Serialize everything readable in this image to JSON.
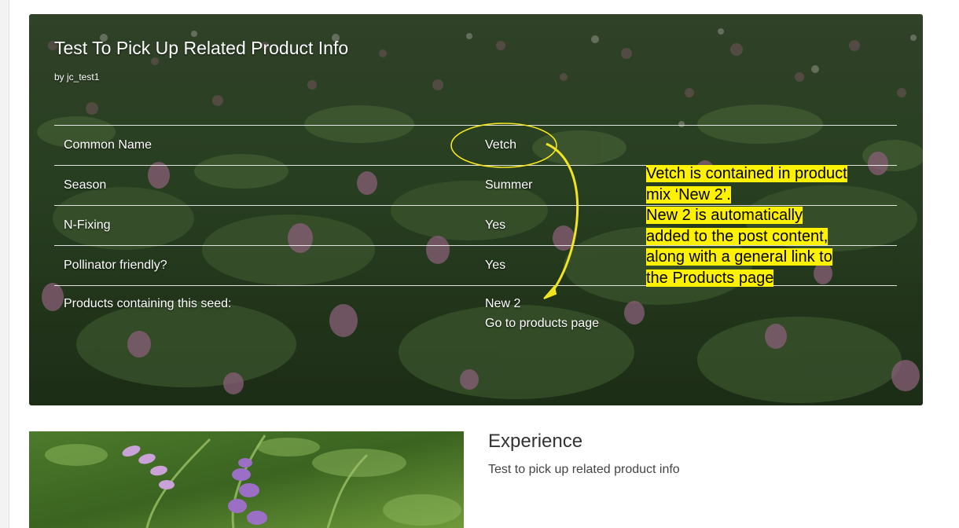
{
  "post": {
    "title": "Test To Pick Up Related Product Info",
    "author": "by jc_test1"
  },
  "table": {
    "rows": [
      {
        "label": "Common Name",
        "value": "Vetch"
      },
      {
        "label": "Season",
        "value": "Summer"
      },
      {
        "label": "N-Fixing",
        "value": "Yes"
      },
      {
        "label": "Pollinator friendly?",
        "value": "Yes"
      },
      {
        "label": "Products containing this seed:",
        "value": "New 2",
        "link": "Go to products page"
      }
    ]
  },
  "annotation": {
    "lines": [
      "Vetch is contained in product",
      "mix ‘New 2’.",
      "New 2 is automatically",
      "added to the post content,",
      "along with a general link to",
      "the Products page"
    ],
    "highlight_color": "#fff200",
    "ink_color": "#f2e51f"
  },
  "card": {
    "title": "Experience",
    "excerpt": "Test to pick up related product info"
  }
}
